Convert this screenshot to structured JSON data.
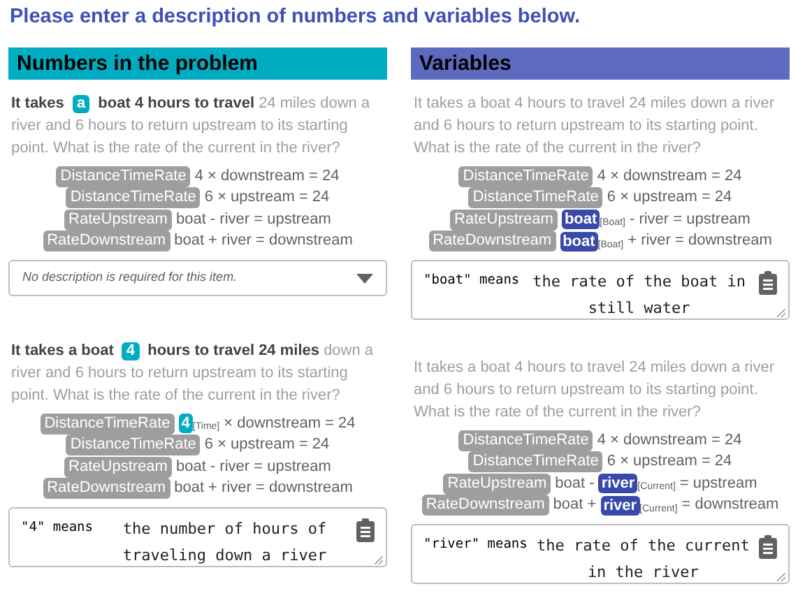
{
  "title": "Please enter a description of numbers and variables below.",
  "columns": [
    {
      "heading": "Numbers in the problem",
      "color": "#00acc1",
      "cards": [
        {
          "problem": [
            {
              "kind": "bold",
              "text": "It takes"
            },
            {
              "kind": "token",
              "text": "a"
            },
            {
              "kind": "bold",
              "text": "boat 4 hours to travel"
            },
            {
              "kind": "plain",
              "text": "24 miles down a river and 6 hours to return upstream to its starting point. What is the rate of the current in the river?"
            }
          ],
          "equations": [
            {
              "tag": "DistanceTimeRate",
              "parts": [
                {
                  "kind": "text",
                  "text": "4 × downstream = 24"
                }
              ]
            },
            {
              "tag": "DistanceTimeRate",
              "parts": [
                {
                  "kind": "text",
                  "text": "6 × upstream = 24"
                }
              ]
            },
            {
              "tag": "RateUpstream",
              "parts": [
                {
                  "kind": "text",
                  "text": "boat - river = upstream"
                }
              ]
            },
            {
              "tag": "RateDownstream",
              "parts": [
                {
                  "kind": "text",
                  "text": "boat + river = downstream"
                }
              ]
            }
          ],
          "field": {
            "kind": "select",
            "placeholder": "No description is required for this item."
          }
        },
        {
          "problem": [
            {
              "kind": "bold",
              "text": "It takes a boat"
            },
            {
              "kind": "token",
              "text": "4"
            },
            {
              "kind": "bold",
              "text": "hours to travel 24 miles"
            },
            {
              "kind": "plain",
              "text": "down a river and 6 hours to return upstream to its starting point. What is the rate of the current in the river?"
            }
          ],
          "equations": [
            {
              "tag": "DistanceTimeRate",
              "parts": [
                {
                  "kind": "token",
                  "text": "4",
                  "sub": "[Time]"
                },
                {
                  "kind": "text",
                  "text": "× downstream = 24"
                }
              ]
            },
            {
              "tag": "DistanceTimeRate",
              "parts": [
                {
                  "kind": "text",
                  "text": "6 × upstream = 24"
                }
              ]
            },
            {
              "tag": "RateUpstream",
              "parts": [
                {
                  "kind": "text",
                  "text": "boat - river = upstream"
                }
              ]
            },
            {
              "tag": "RateDownstream",
              "parts": [
                {
                  "kind": "text",
                  "text": "boat + river = downstream"
                }
              ]
            }
          ],
          "field": {
            "kind": "textarea",
            "label": "\"4\" means",
            "value": "the number of hours of traveling down a river"
          }
        }
      ]
    },
    {
      "heading": "Variables",
      "color": "#5c6bc0",
      "cards": [
        {
          "problem": [
            {
              "kind": "plain",
              "text": "It takes a boat 4 hours to travel 24 miles down a river and 6 hours to return upstream to its starting point. What is the rate of the current in the river?"
            }
          ],
          "equations": [
            {
              "tag": "DistanceTimeRate",
              "parts": [
                {
                  "kind": "text",
                  "text": "4 × downstream = 24"
                }
              ]
            },
            {
              "tag": "DistanceTimeRate",
              "parts": [
                {
                  "kind": "text",
                  "text": "6 × upstream = 24"
                }
              ]
            },
            {
              "tag": "RateUpstream",
              "parts": [
                {
                  "kind": "token",
                  "text": "boat",
                  "sub": "[Boat]"
                },
                {
                  "kind": "text",
                  "text": "- river = upstream"
                }
              ]
            },
            {
              "tag": "RateDownstream",
              "parts": [
                {
                  "kind": "token",
                  "text": "boat",
                  "sub": "[Boat]"
                },
                {
                  "kind": "text",
                  "text": "+ river = downstream"
                }
              ]
            }
          ],
          "field": {
            "kind": "textarea",
            "label": "\"boat\" means",
            "value": "the rate of the boat in still water"
          }
        },
        {
          "problem": [
            {
              "kind": "plain",
              "text": "It takes a boat 4 hours to travel 24 miles down a river and 6 hours to return upstream to its starting point. What is the rate of the current in the river?"
            }
          ],
          "equations": [
            {
              "tag": "DistanceTimeRate",
              "parts": [
                {
                  "kind": "text",
                  "text": "4 × downstream = 24"
                }
              ]
            },
            {
              "tag": "DistanceTimeRate",
              "parts": [
                {
                  "kind": "text",
                  "text": "6 × upstream = 24"
                }
              ]
            },
            {
              "tag": "RateUpstream",
              "parts": [
                {
                  "kind": "text",
                  "text": "boat -"
                },
                {
                  "kind": "token",
                  "text": "river",
                  "sub": "[Current]"
                },
                {
                  "kind": "text",
                  "text": "= upstream"
                }
              ]
            },
            {
              "tag": "RateDownstream",
              "parts": [
                {
                  "kind": "text",
                  "text": "boat +"
                },
                {
                  "kind": "token",
                  "text": "river",
                  "sub": "[Current]"
                },
                {
                  "kind": "text",
                  "text": "= downstream"
                }
              ]
            }
          ],
          "field": {
            "kind": "textarea",
            "label": "\"river\" means",
            "value": "the rate of the current in the river"
          }
        }
      ]
    }
  ]
}
